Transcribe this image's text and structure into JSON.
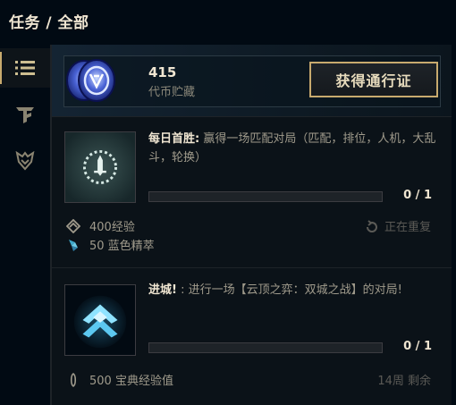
{
  "header": {
    "title": "任务 / 全部"
  },
  "sidebar": {
    "items": [
      {
        "name": "list-icon",
        "active": true
      },
      {
        "name": "tft-icon",
        "active": false
      },
      {
        "name": "crest-icon",
        "active": false
      }
    ]
  },
  "currency": {
    "amount": "415",
    "label": "代币贮藏",
    "button_label": "获得通行证"
  },
  "missions": [
    {
      "title_bold": "每日首胜:",
      "title_rest": " 赢得一场匹配对局（匹配，排位，人机，大乱斗，轮换）",
      "progress": 0,
      "progress_text": "0 / 1",
      "rewards": [
        {
          "icon": "experience-icon",
          "text": "400经验"
        },
        {
          "icon": "blue-essence-icon",
          "text": "50 蓝色精萃"
        }
      ],
      "status": {
        "icon": "repeat-icon",
        "text": "正在重复"
      }
    },
    {
      "title_bold": "进城!",
      "title_rest": " : 进行一场【云顶之弈：双城之战】的对局!",
      "progress": 0,
      "progress_text": "0 / 1",
      "rewards": [
        {
          "icon": "codex-xp-icon",
          "text": "500 宝典经验值"
        }
      ],
      "status": {
        "icon": "",
        "text": "14周 剩余"
      }
    }
  ],
  "colors": {
    "gold": "#c8aa6e",
    "text_light": "#f0e6d2",
    "text_muted": "#a09b8c",
    "background": "#010a13"
  }
}
